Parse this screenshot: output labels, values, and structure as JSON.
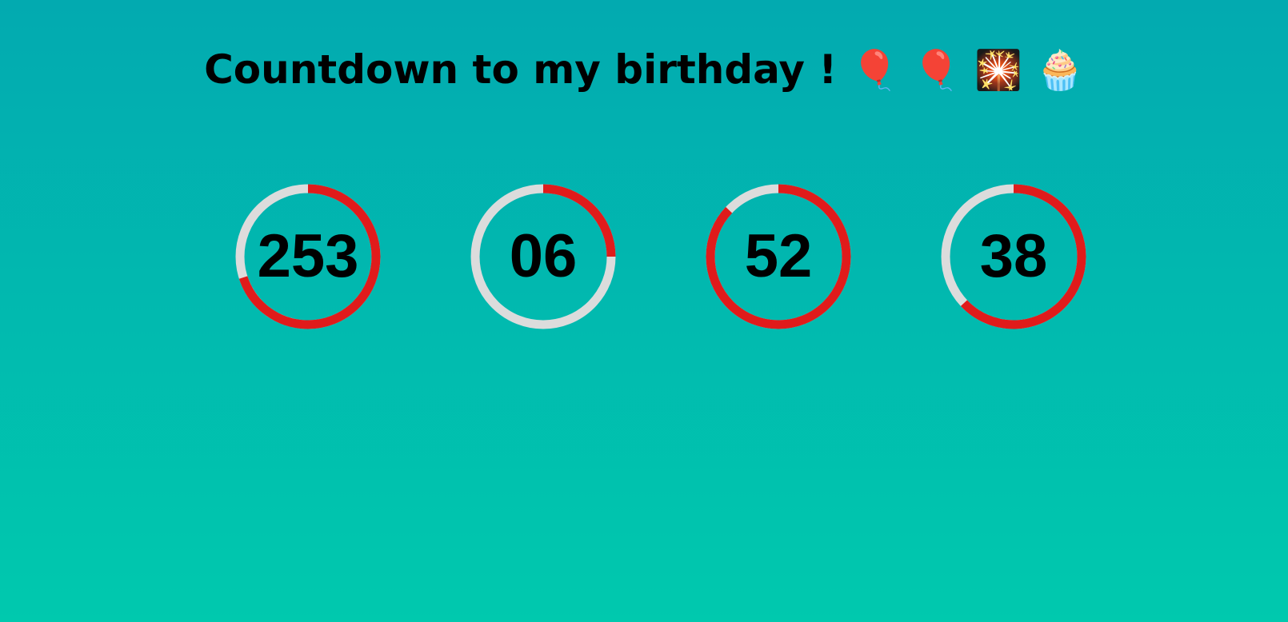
{
  "title": {
    "text": "Countdown to my birthday !",
    "emojis": [
      {
        "icon": "balloon-icon",
        "glyph": "🎈"
      },
      {
        "icon": "balloon-icon",
        "glyph": "🎈"
      },
      {
        "icon": "sparkler-icon",
        "glyph": "🎇"
      },
      {
        "icon": "cupcake-icon",
        "glyph": "🧁"
      }
    ]
  },
  "colors": {
    "progress": "#e01b1b",
    "track": "#dcdcdc",
    "background_top": "#02aab0",
    "background_bottom": "#00c9ae"
  },
  "counters": [
    {
      "value": "253",
      "progress": 0.7
    },
    {
      "value": "06",
      "progress": 0.25
    },
    {
      "value": "52",
      "progress": 0.87
    },
    {
      "value": "38",
      "progress": 0.63
    }
  ]
}
